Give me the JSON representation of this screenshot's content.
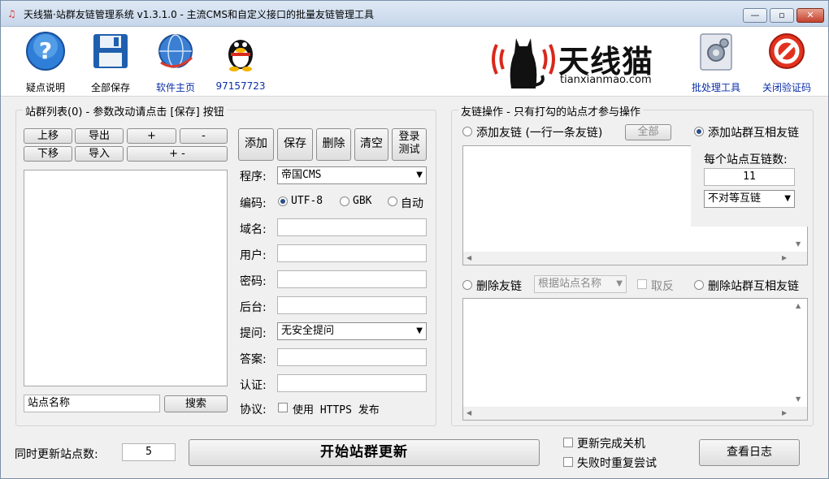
{
  "window": {
    "title": "天线猫·站群友链管理系统 v1.3.1.0 - 主流CMS和自定义接口的批量友链管理工具",
    "controls": {
      "minimize": "—",
      "maximize": "▫",
      "close": "✕"
    }
  },
  "toolbar": {
    "items": [
      {
        "label": "疑点说明",
        "icon": "help-icon"
      },
      {
        "label": "全部保存",
        "icon": "save-icon"
      },
      {
        "label": "软件主页",
        "icon": "globe-icon"
      },
      {
        "label": "97157723",
        "icon": "qq-penguin-icon"
      }
    ],
    "logo": {
      "name": "天线猫",
      "url": "tianxianmao.com"
    },
    "right_items": [
      {
        "label": "批处理工具",
        "icon": "batch-tool-icon"
      },
      {
        "label": "关闭验证码",
        "icon": "stop-icon"
      }
    ]
  },
  "sites": {
    "group_title": "站群列表(0) - 参数改动请点击 [保存] 按钮",
    "buttons": {
      "move_up": "上移",
      "export": "导出",
      "plus": "+",
      "minus": "-",
      "move_down": "下移",
      "import": "导入",
      "plus_minus": "+ -"
    },
    "search_value": "站点名称",
    "search_button": "搜索"
  },
  "form": {
    "actions": {
      "add": "添加",
      "save": "保存",
      "delete": "删除",
      "clear": "清空",
      "login_test_1": "登录",
      "login_test_2": "测试"
    },
    "program_label": "程序:",
    "program_value": "帝国CMS",
    "encoding_label": "编码:",
    "encoding_options": [
      "UTF-8",
      "GBK",
      "自动"
    ],
    "encoding_selected": "UTF-8",
    "domain_label": "域名:",
    "user_label": "用户:",
    "password_label": "密码:",
    "backend_label": "后台:",
    "question_label": "提问:",
    "question_value": "无安全提问",
    "answer_label": "答案:",
    "auth_label": "认证:",
    "protocol_label": "协议:",
    "protocol_check": "使用 HTTPS 发布"
  },
  "links": {
    "group_title": "友链操作 - 只有打勾的站点才参与操作",
    "add_link_label": "添加友链 (一行一条友链)",
    "all_button": "全部",
    "add_mutual_label": "添加站群互相友链",
    "per_site_label": "每个站点互链数:",
    "per_site_value": "11",
    "mutual_mode": "不对等互链",
    "delete_link_label": "删除友链",
    "delete_by": "根据站点名称",
    "invert_label": "取反",
    "delete_mutual_label": "删除站群互相友链"
  },
  "bottom": {
    "concurrent_label": "同时更新站点数:",
    "concurrent_value": "5",
    "start_button": "开始站群更新",
    "shutdown_label": "更新完成关机",
    "retry_label": "失败时重复尝试",
    "log_button": "查看日志"
  },
  "colors": {
    "accent_link": "#0b2fa8",
    "logo_red": "#d8281c",
    "background": "#f0f0f0"
  }
}
